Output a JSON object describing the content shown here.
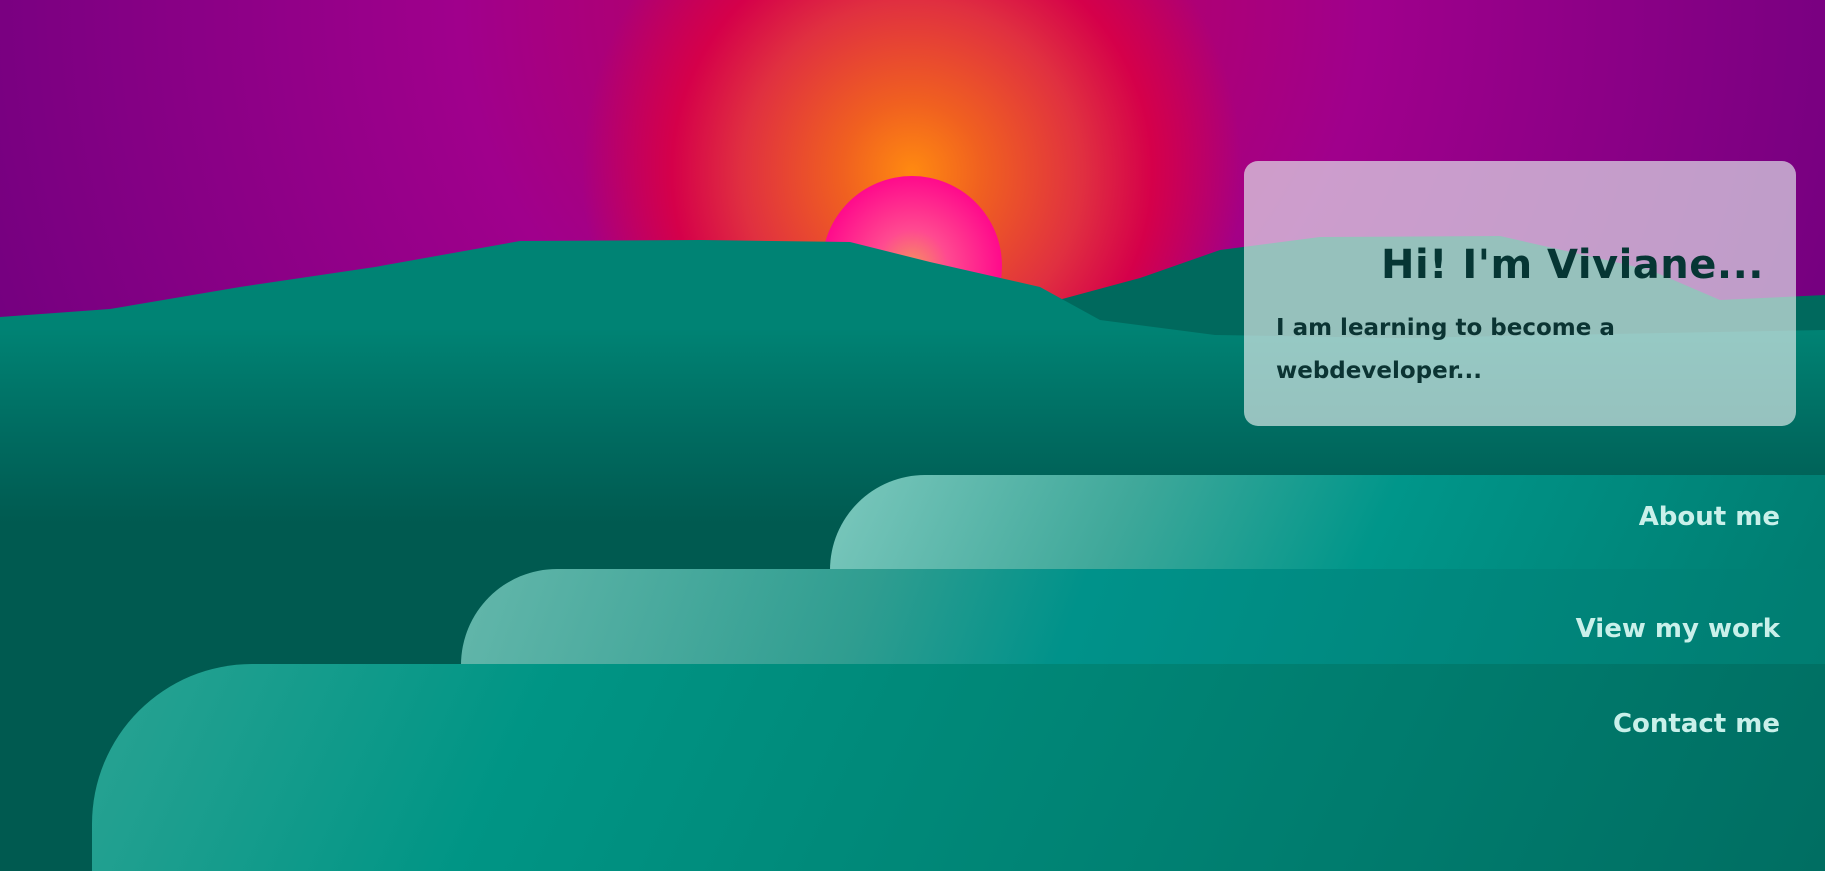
{
  "intro": {
    "title": "Hi! I'm Viviane...",
    "text": "I am learning to become a webdeveloper..."
  },
  "nav": {
    "about": "About me",
    "work": "View my work",
    "contact": "Contact me"
  },
  "colors": {
    "sky_edge": "#5a0078",
    "sky_mid": "#a0008c",
    "sun_glow": "#ff8a10",
    "sun_disc": "#ff0a8c",
    "hills": "#008374",
    "hills_dark": "#005a50",
    "card_text": "#063634",
    "nav_text": "#c9f0ea"
  }
}
